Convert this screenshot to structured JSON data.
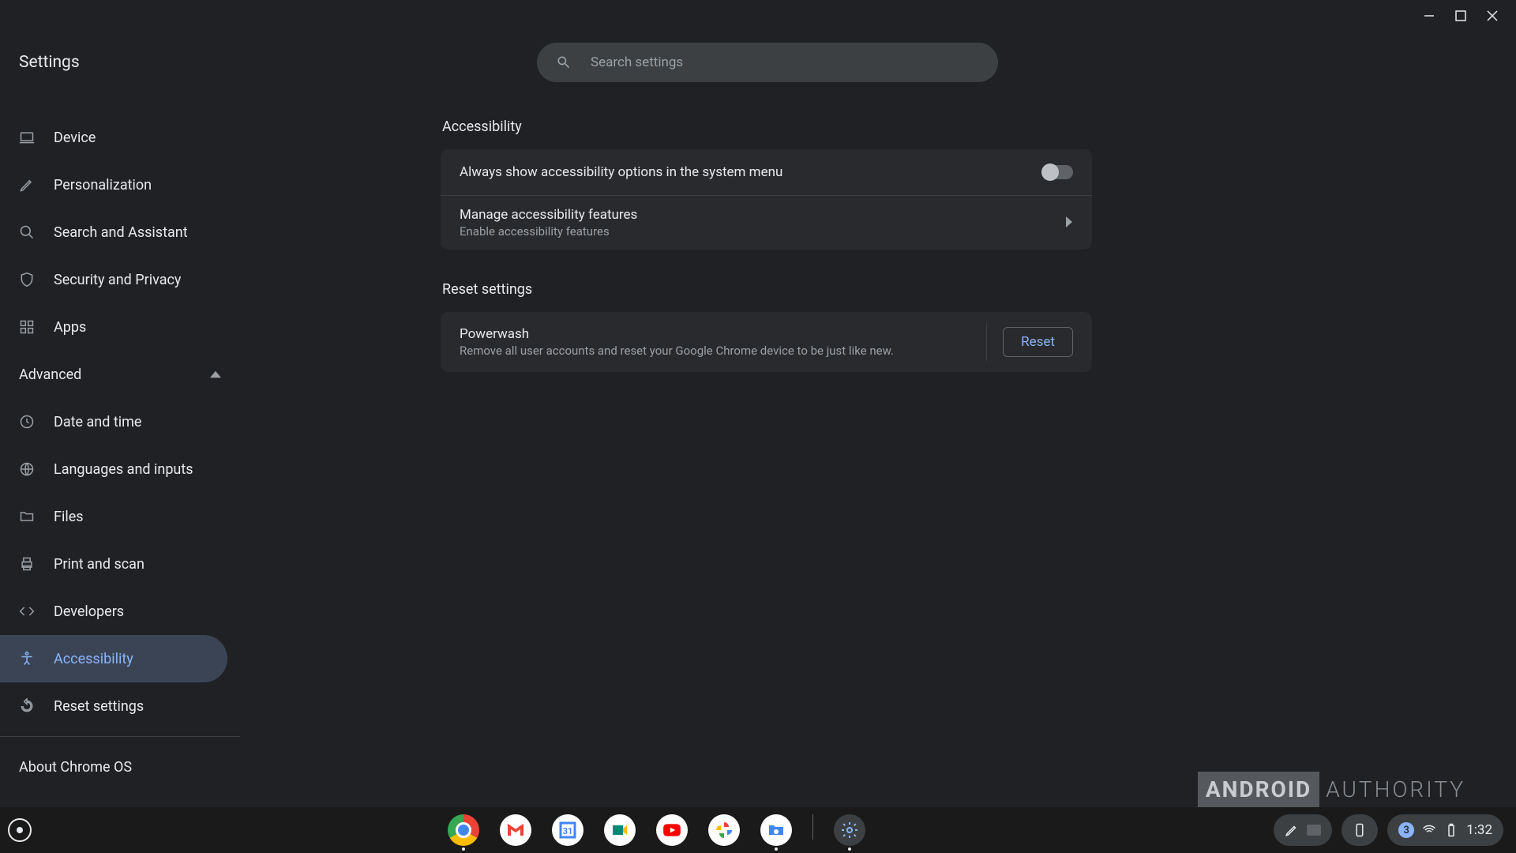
{
  "window": {
    "title": "Settings"
  },
  "search": {
    "placeholder": "Search settings"
  },
  "sidebar": {
    "items": [
      {
        "label": "Device",
        "icon": "laptop"
      },
      {
        "label": "Personalization",
        "icon": "pencil"
      },
      {
        "label": "Search and Assistant",
        "icon": "search"
      },
      {
        "label": "Security and Privacy",
        "icon": "shield"
      },
      {
        "label": "Apps",
        "icon": "grid"
      }
    ],
    "advanced_label": "Advanced",
    "advanced_items": [
      {
        "label": "Date and time",
        "icon": "clock"
      },
      {
        "label": "Languages and inputs",
        "icon": "globe"
      },
      {
        "label": "Files",
        "icon": "folder"
      },
      {
        "label": "Print and scan",
        "icon": "printer"
      },
      {
        "label": "Developers",
        "icon": "code"
      },
      {
        "label": "Accessibility",
        "icon": "accessibility",
        "active": true
      },
      {
        "label": "Reset settings",
        "icon": "reset"
      }
    ],
    "about_label": "About Chrome OS"
  },
  "sections": {
    "accessibility": {
      "title": "Accessibility",
      "row_toggle": {
        "label": "Always show accessibility options in the system menu",
        "on": false
      },
      "row_nav": {
        "title": "Manage accessibility features",
        "sub": "Enable accessibility features"
      }
    },
    "reset": {
      "title": "Reset settings",
      "powerwash": {
        "title": "Powerwash",
        "sub": "Remove all user accounts and reset your Google Chrome device to be just like new.",
        "button": "Reset"
      }
    }
  },
  "watermark": {
    "brand_box": "ANDROID",
    "brand_text": "AUTHORITY"
  },
  "shelf": {
    "apps": [
      "chrome",
      "gmail",
      "calendar",
      "meet",
      "youtube",
      "photos",
      "files",
      "settings"
    ],
    "running": [
      "chrome",
      "files",
      "settings"
    ],
    "status": {
      "notif_count": "3",
      "time": "1:32"
    }
  }
}
